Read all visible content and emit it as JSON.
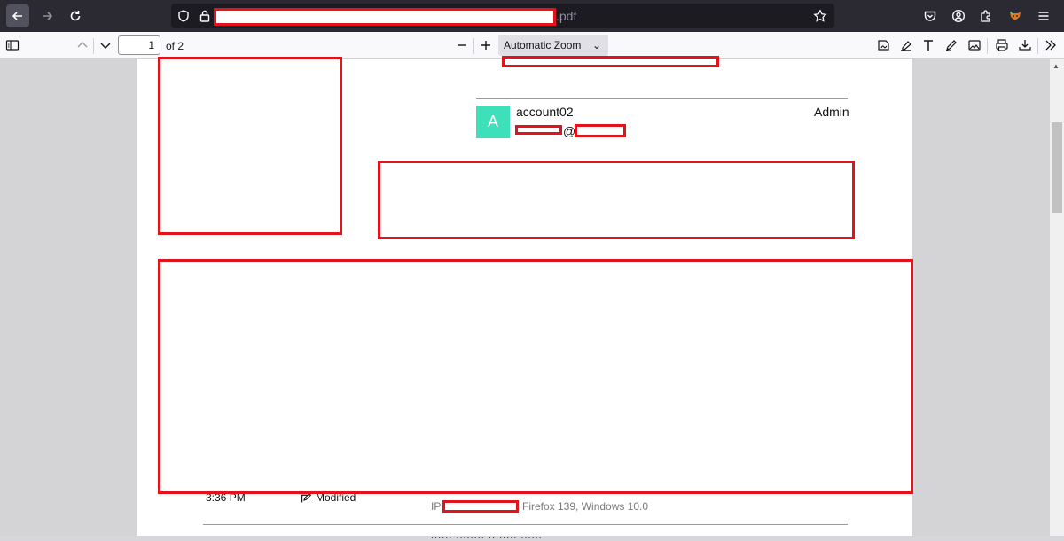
{
  "browser": {
    "url_suffix": ".pdf",
    "nav": {
      "back": "back-arrow",
      "forward": "forward-arrow",
      "reload": "reload"
    }
  },
  "pdf_toolbar": {
    "current_page": "1",
    "page_total": "of 2",
    "zoom_label": "Automatic Zoom",
    "zoom_chevron": "⌄"
  },
  "document": {
    "account": {
      "avatar_letter": "A",
      "name": "account02",
      "role": "Admin",
      "email_at": "@"
    },
    "log_row": {
      "time": "3:36 PM",
      "action": "Modified",
      "ip_label": "IP",
      "browser_info": "Firefox 139, Windows 10.0"
    },
    "cut_text": "...... ........ ........ ......"
  },
  "colors": {
    "redaction": "#e3131b",
    "avatar_bg": "#3de0b8",
    "toolbar_bg": "#f9f9fb",
    "navbar_bg": "#2b2a33"
  }
}
